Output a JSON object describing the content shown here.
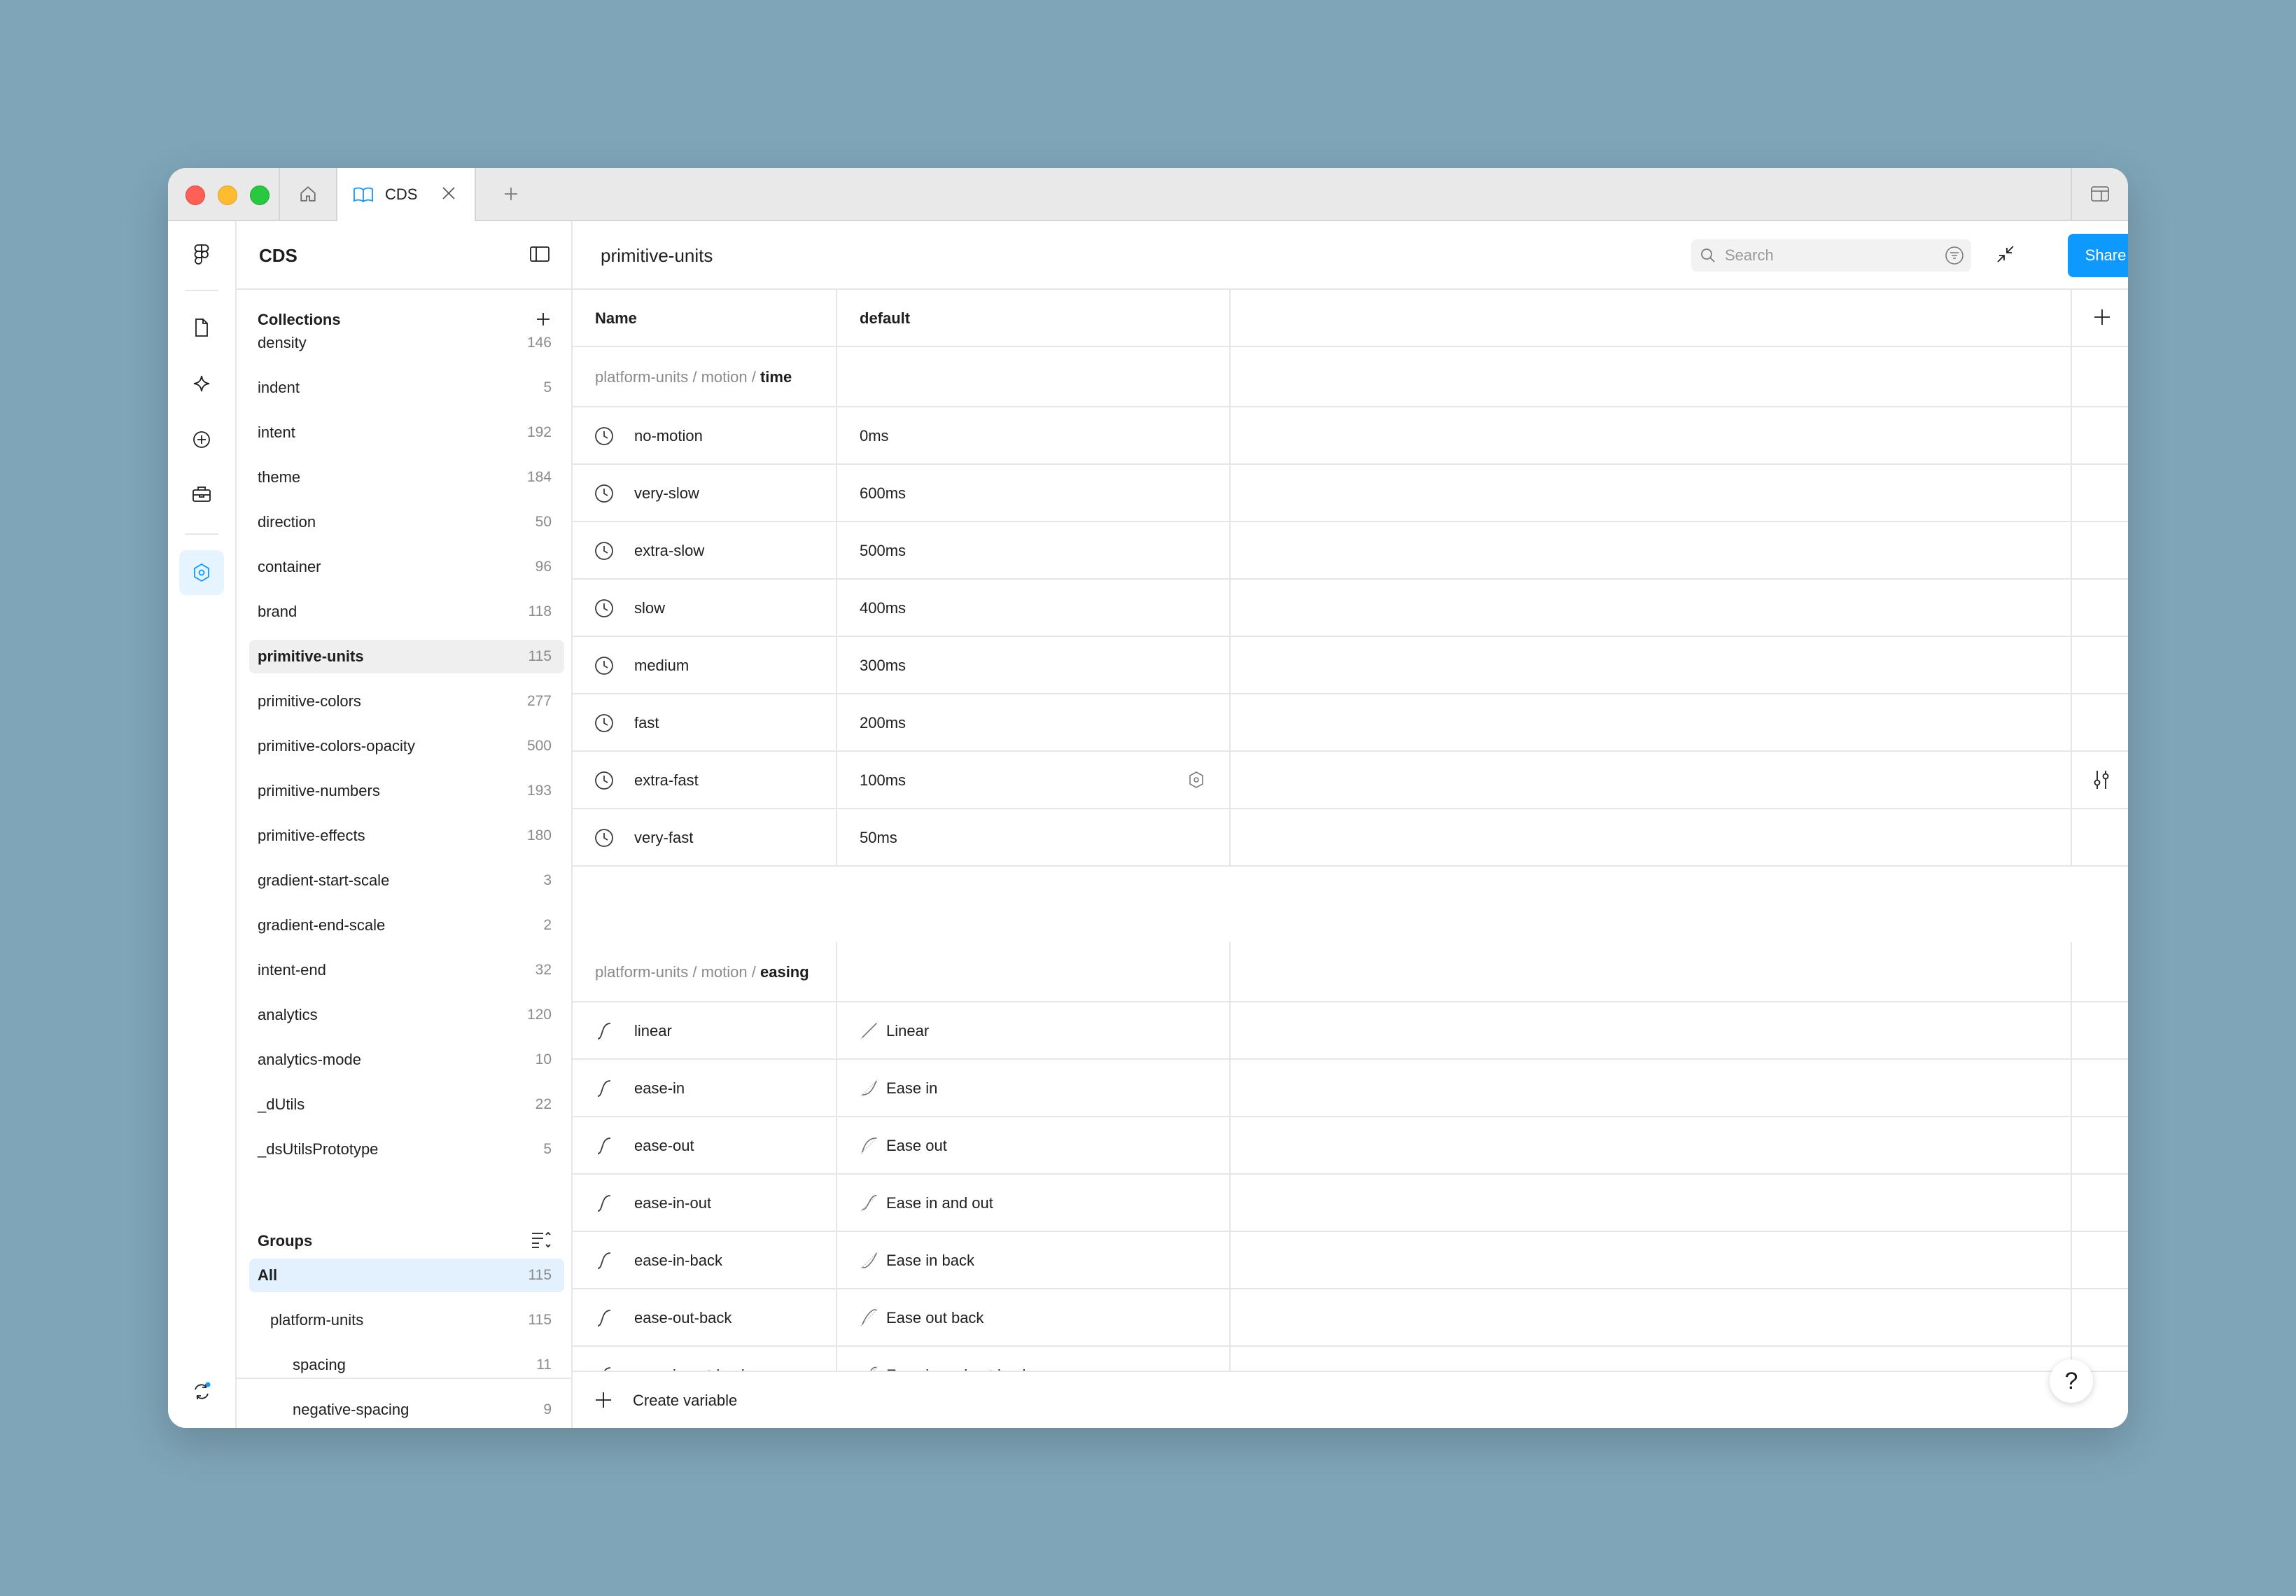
{
  "titlebar": {
    "tab_label": "CDS"
  },
  "panel": {
    "title": "CDS",
    "collections_title": "Collections",
    "collections": [
      {
        "label": "density",
        "count": "146"
      },
      {
        "label": "indent",
        "count": "5"
      },
      {
        "label": "intent",
        "count": "192"
      },
      {
        "label": "theme",
        "count": "184"
      },
      {
        "label": "direction",
        "count": "50"
      },
      {
        "label": "container",
        "count": "96"
      },
      {
        "label": "brand",
        "count": "118"
      },
      {
        "label": "primitive-units",
        "count": "115"
      },
      {
        "label": "primitive-colors",
        "count": "277"
      },
      {
        "label": "primitive-colors-opacity",
        "count": "500"
      },
      {
        "label": "primitive-numbers",
        "count": "193"
      },
      {
        "label": "primitive-effects",
        "count": "180"
      },
      {
        "label": "gradient-start-scale",
        "count": "3"
      },
      {
        "label": "gradient-end-scale",
        "count": "2"
      },
      {
        "label": "intent-end",
        "count": "32"
      },
      {
        "label": "analytics",
        "count": "120"
      },
      {
        "label": "analytics-mode",
        "count": "10"
      },
      {
        "label": "_dUtils",
        "count": "22"
      },
      {
        "label": "_dsUtilsPrototype",
        "count": "5"
      }
    ],
    "groups_title": "Groups",
    "groups": [
      {
        "label": "All",
        "count": "115"
      },
      {
        "label": "platform-units",
        "count": "115"
      },
      {
        "label": "spacing",
        "count": "11"
      },
      {
        "label": "negative-spacing",
        "count": "9"
      }
    ]
  },
  "main": {
    "title": "primitive-units",
    "search_placeholder": "Search",
    "share_label": "Share",
    "col_name": "Name",
    "col_default": "default",
    "time_group": {
      "path": "platform-units / motion / ",
      "leaf": "time"
    },
    "time_rows": [
      {
        "name": "no-motion",
        "value": "0ms"
      },
      {
        "name": "very-slow",
        "value": "600ms"
      },
      {
        "name": "extra-slow",
        "value": "500ms"
      },
      {
        "name": "slow",
        "value": "400ms"
      },
      {
        "name": "medium",
        "value": "300ms"
      },
      {
        "name": "fast",
        "value": "200ms"
      },
      {
        "name": "extra-fast",
        "value": "100ms"
      },
      {
        "name": "very-fast",
        "value": "50ms"
      }
    ],
    "easing_group": {
      "path": "platform-units / motion / ",
      "leaf": "easing"
    },
    "easing_rows": [
      {
        "name": "linear",
        "value": "Linear"
      },
      {
        "name": "ease-in",
        "value": "Ease in"
      },
      {
        "name": "ease-out",
        "value": "Ease out"
      },
      {
        "name": "ease-in-out",
        "value": "Ease in and out"
      },
      {
        "name": "ease-in-back",
        "value": "Ease in back"
      },
      {
        "name": "ease-out-back",
        "value": "Ease out back"
      },
      {
        "name": "ease-in-out-back",
        "value": "Ease in and out back"
      }
    ],
    "create_label": "Create variable",
    "help_label": "?"
  },
  "colors": {
    "accent": "#0d99ff",
    "selection": "#e2f1fd"
  }
}
